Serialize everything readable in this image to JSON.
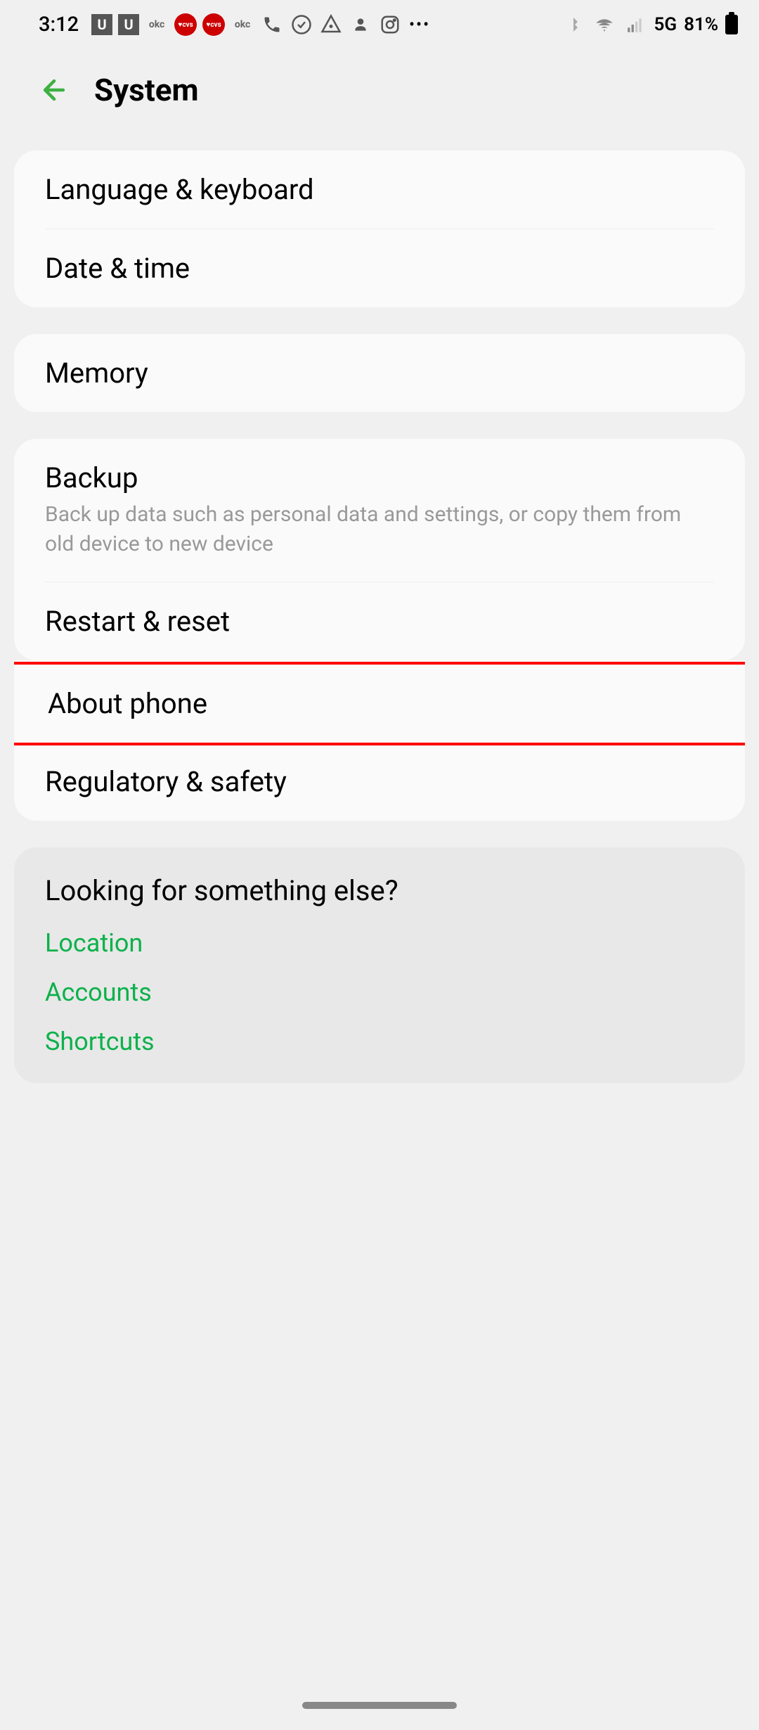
{
  "status": {
    "time": "3:12",
    "network": "5G",
    "battery": "81%"
  },
  "page": {
    "title": "System"
  },
  "groups": {
    "g1": {
      "item1": "Language & keyboard",
      "item2": "Date & time"
    },
    "g2": {
      "item1": "Memory"
    },
    "g3": {
      "item1_title": "Backup",
      "item1_subtitle": "Back up data such as personal data and settings, or copy them from old device to new device",
      "item2": "Restart & reset"
    },
    "g4": {
      "item1": "About phone",
      "item2": "Regulatory & safety"
    }
  },
  "suggestions": {
    "title": "Looking for something else?",
    "links": {
      "l1": "Location",
      "l2": "Accounts",
      "l3": "Shortcuts"
    }
  }
}
